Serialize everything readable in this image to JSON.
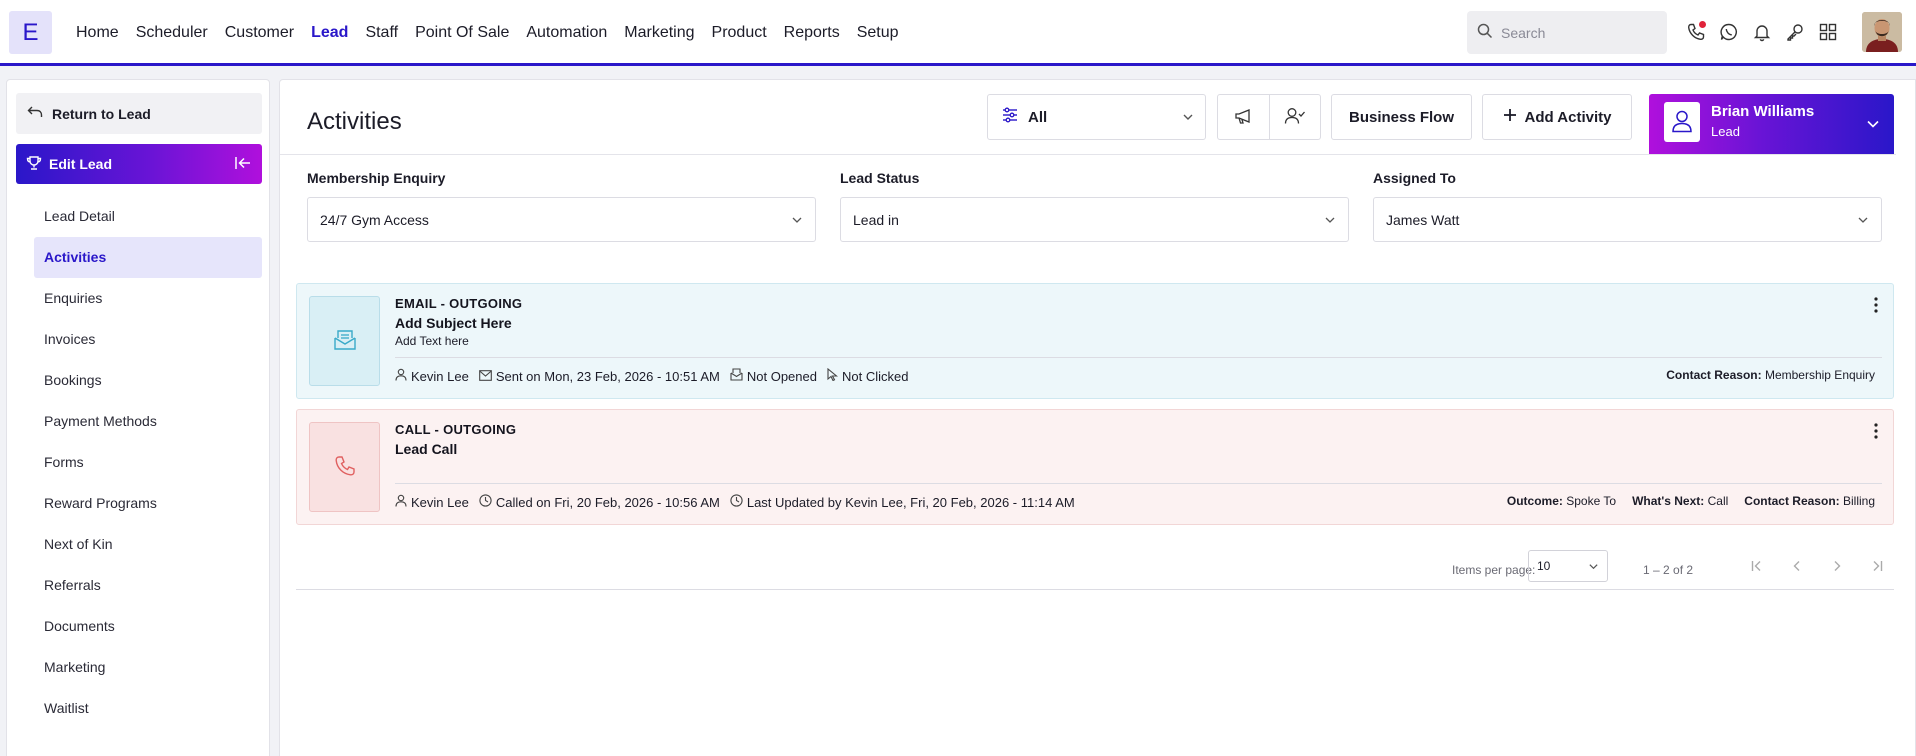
{
  "app": {
    "logo_letter": "E"
  },
  "nav": {
    "items": [
      "Home",
      "Scheduler",
      "Customer",
      "Lead",
      "Staff",
      "Point Of Sale",
      "Automation",
      "Marketing",
      "Product",
      "Reports",
      "Setup"
    ],
    "active": "Lead"
  },
  "search": {
    "placeholder": "Search"
  },
  "sidebar": {
    "return_label": "Return to Lead",
    "edit_label": "Edit Lead",
    "items": [
      "Lead Detail",
      "Activities",
      "Enquiries",
      "Invoices",
      "Bookings",
      "Payment Methods",
      "Forms",
      "Reward Programs",
      "Next of Kin",
      "Referrals",
      "Documents",
      "Marketing",
      "Waitlist"
    ],
    "active": "Activities"
  },
  "main": {
    "title": "Activities",
    "filter_value": "All",
    "business_flow_label": "Business Flow",
    "add_activity_label": "Add Activity",
    "lead": {
      "name": "Brian Williams",
      "role": "Lead"
    },
    "fields": {
      "membership": {
        "label": "Membership Enquiry",
        "value": "24/7 Gym Access"
      },
      "status": {
        "label": "Lead Status",
        "value": "Lead in"
      },
      "assigned": {
        "label": "Assigned To",
        "value": "James Watt"
      }
    }
  },
  "activities": [
    {
      "type": "EMAIL - OUTGOING",
      "subject": "Add Subject Here",
      "text": "Add Text here",
      "staff": "Kevin Lee",
      "sent": "Sent on Mon, 23 Feb, 2026 - 10:51 AM",
      "opened": "Not Opened",
      "clicked": "Not Clicked",
      "contact_reason_label": "Contact Reason:",
      "contact_reason": "Membership Enquiry"
    },
    {
      "type": "CALL - OUTGOING",
      "subject": "Lead Call",
      "staff": "Kevin Lee",
      "called": "Called on Fri, 20 Feb, 2026 - 10:56 AM",
      "updated": "Last Updated by Kevin Lee, Fri, 20 Feb, 2026 - 11:14 AM",
      "outcome_label": "Outcome:",
      "outcome": "Spoke To",
      "next_label": "What's Next:",
      "next": "Call",
      "contact_reason_label": "Contact Reason:",
      "contact_reason": "Billing"
    }
  ],
  "pagination": {
    "items_per_page_label": "Items per page:",
    "items_per_page": "10",
    "range": "1 – 2 of 2"
  },
  "colors": {
    "accent": "#2a17c9",
    "gradient_end": "#b010dc",
    "email_bg": "#edf7fa",
    "call_bg": "#fcf2f2"
  }
}
